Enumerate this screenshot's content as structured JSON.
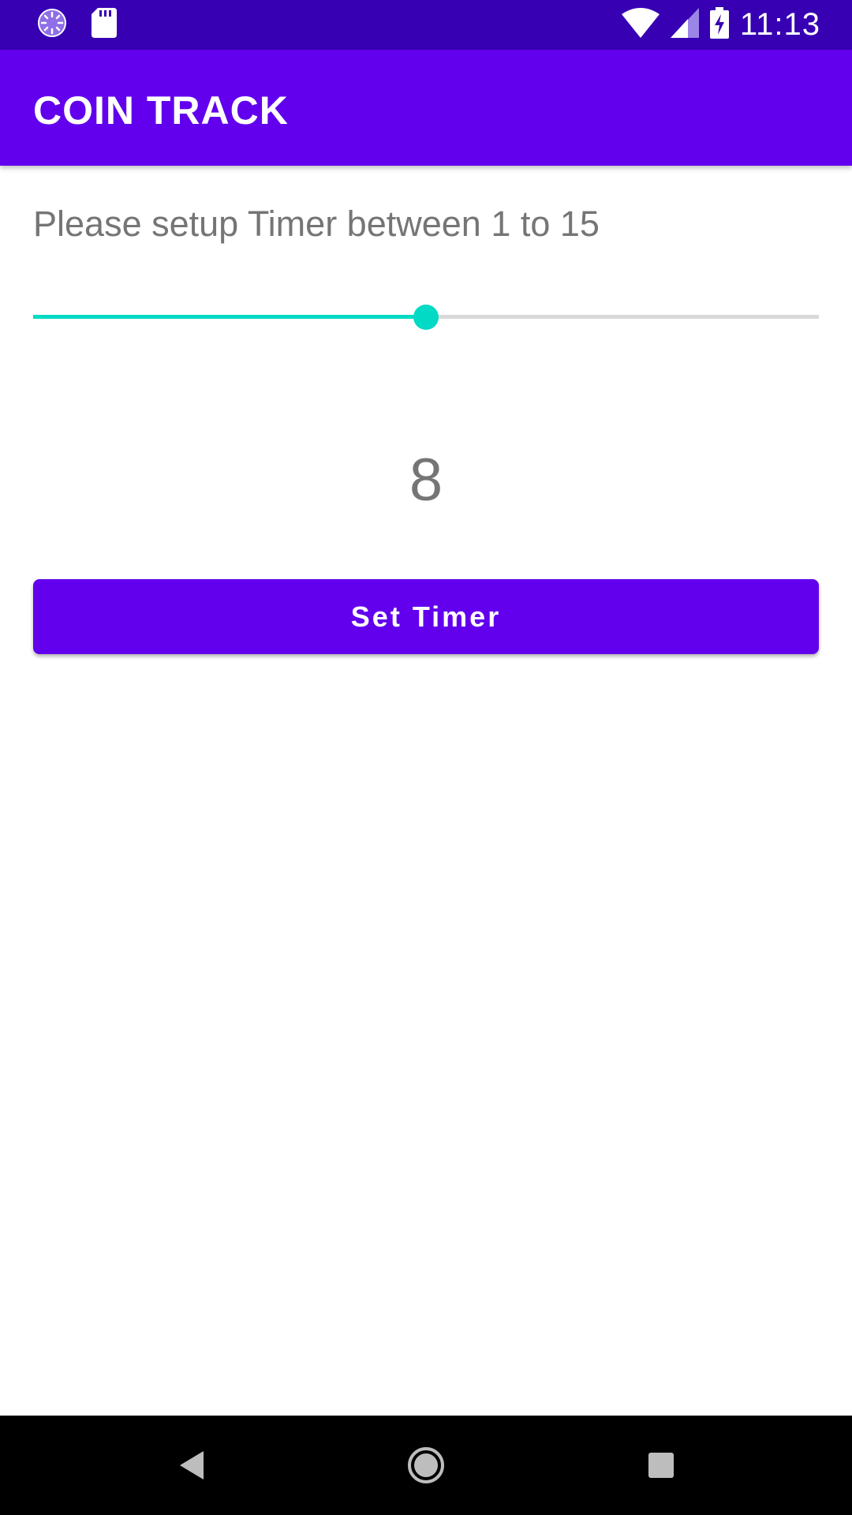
{
  "status_bar": {
    "time": "11:13",
    "icons": [
      "loading-icon",
      "sd-card-icon",
      "wifi-icon",
      "cell-signal-icon",
      "battery-charging-icon"
    ]
  },
  "app_bar": {
    "title": "COIN TRACK"
  },
  "content": {
    "prompt": "Please setup Timer between 1 to 15",
    "slider": {
      "min": 1,
      "max": 15,
      "value": 8
    },
    "value_display": "8",
    "button_label": "Set Timer"
  },
  "nav_bar": {
    "buttons": [
      "back-icon",
      "home-icon",
      "recents-icon"
    ]
  },
  "colors": {
    "primary": "#6200EE",
    "primary_dark": "#3700B3",
    "accent": "#03DAC5",
    "text_secondary": "#757575"
  }
}
